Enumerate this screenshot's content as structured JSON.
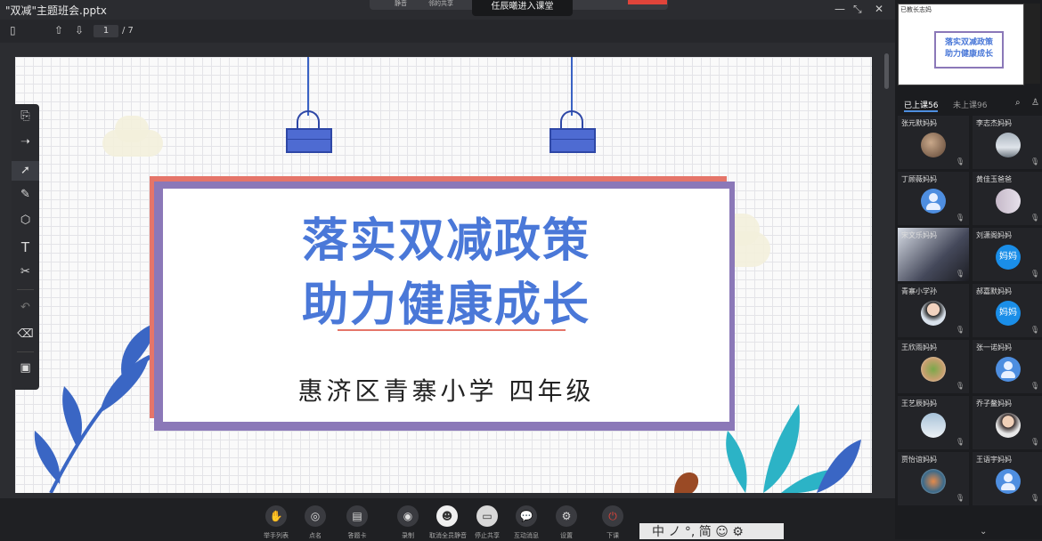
{
  "window": {
    "title": "\"双减\"主题班会.pptx",
    "toast": "任辰曦进入课堂",
    "top_controls": [
      "静音",
      "邻的共享"
    ]
  },
  "toolbar": {
    "page_current": "1",
    "page_total": "/ 7"
  },
  "slide": {
    "title_line1": "落实双减政策",
    "title_line2": "助力健康成长",
    "subtitle": "惠济区青寨小学 四年级",
    "colors": {
      "title": "#4a78d8",
      "frame_purple": "#8b78b8",
      "frame_coral": "#e57569",
      "bag": "#4e6bd2",
      "leaf_blue": "#3a66c4",
      "leaf_teal": "#2cb3c6"
    }
  },
  "preview": {
    "label": "已教长志妈",
    "line1": "落实双减政策",
    "line2": "助力健康成长"
  },
  "bottom_bar": [
    {
      "label": "举手列表",
      "icon": "hand-icon"
    },
    {
      "label": "点名",
      "icon": "rollcall-icon"
    },
    {
      "label": "答题卡",
      "icon": "answer-card-icon"
    },
    {
      "label": "录制",
      "icon": "record-icon"
    },
    {
      "label": "取消全员静音",
      "icon": "unmute-all-icon"
    },
    {
      "label": "停止共享",
      "icon": "stop-share-icon"
    },
    {
      "label": "互动消息",
      "icon": "message-icon"
    },
    {
      "label": "设置",
      "icon": "gear-icon"
    },
    {
      "label": "下课",
      "icon": "power-icon"
    }
  ],
  "ime": {
    "text": "中 ノ °, 简 ☺ ⚙"
  },
  "tabs": {
    "active": "已上课56",
    "inactive": "未上课96"
  },
  "participants": [
    {
      "name": "张元默妈妈",
      "avatar": "photo"
    },
    {
      "name": "李志杰妈妈",
      "avatar": "photo"
    },
    {
      "name": "丁顾薇妈妈",
      "avatar": "user"
    },
    {
      "name": "黄佳玉爸爸",
      "avatar": "photo"
    },
    {
      "name": "宋文乐妈妈",
      "avatar": "video"
    },
    {
      "name": "刘潇阁妈妈",
      "avatar": "妈妈"
    },
    {
      "name": "青寨小学孙",
      "avatar": "photo"
    },
    {
      "name": "郝嘉默妈妈",
      "avatar": "妈妈"
    },
    {
      "name": "王欣雨妈妈",
      "avatar": "photo"
    },
    {
      "name": "张一诺妈妈",
      "avatar": "user"
    },
    {
      "name": "王艺辰妈妈",
      "avatar": "photo"
    },
    {
      "name": "乔子鳌妈妈",
      "avatar": "photo"
    },
    {
      "name": "贾怡谊妈妈",
      "avatar": "photo"
    },
    {
      "name": "王语宇妈妈",
      "avatar": "user"
    }
  ]
}
